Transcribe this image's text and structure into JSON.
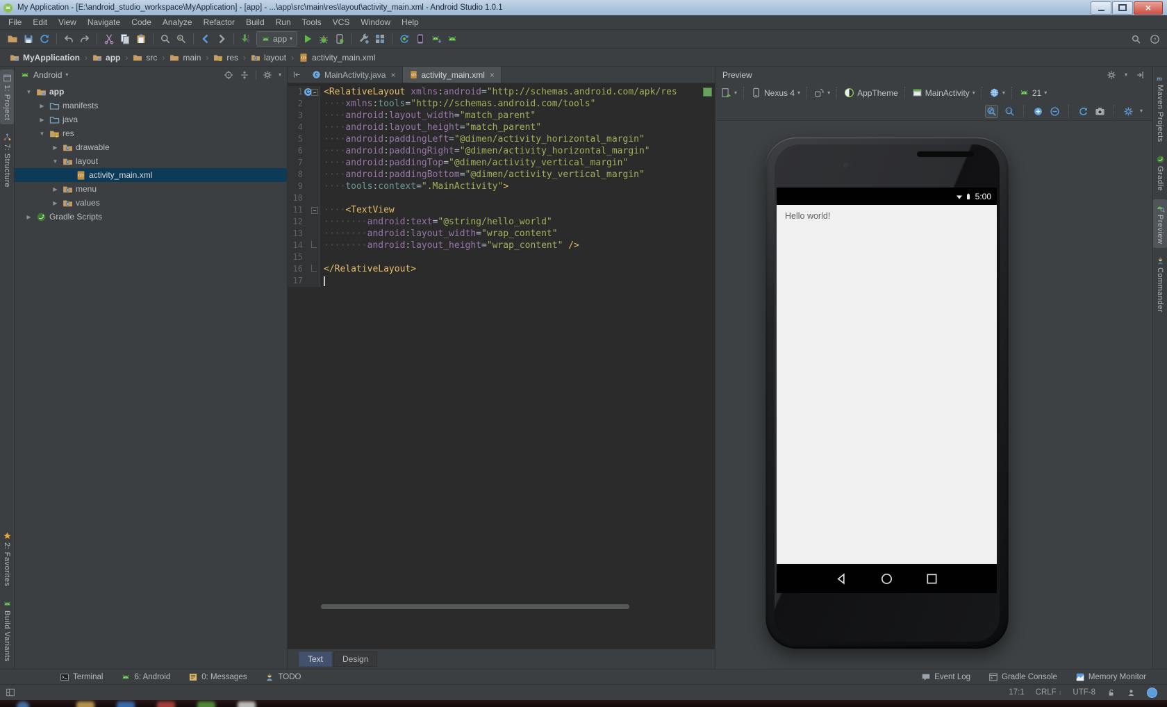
{
  "titlebar": {
    "title": "My Application - [E:\\android_studio_workspace\\MyApplication] - [app] - ...\\app\\src\\main\\res\\layout\\activity_main.xml - Android Studio 1.0.1"
  },
  "menubar": [
    "File",
    "Edit",
    "View",
    "Navigate",
    "Code",
    "Analyze",
    "Refactor",
    "Build",
    "Run",
    "Tools",
    "VCS",
    "Window",
    "Help"
  ],
  "toolbar": {
    "run_config": "app",
    "items": [
      {
        "icon": "folderOpen",
        "name": "open-file"
      },
      {
        "icon": "save",
        "name": "save-all"
      },
      {
        "icon": "sync",
        "name": "synchronize"
      },
      {
        "sep": true
      },
      {
        "icon": "undo",
        "name": "undo"
      },
      {
        "icon": "redo",
        "name": "redo"
      },
      {
        "sep": true
      },
      {
        "icon": "cut",
        "name": "cut"
      },
      {
        "icon": "copy",
        "name": "copy"
      },
      {
        "icon": "paste",
        "name": "paste"
      },
      {
        "sep": true
      },
      {
        "icon": "find",
        "name": "find"
      },
      {
        "icon": "replace",
        "name": "replace"
      },
      {
        "sep": true
      },
      {
        "icon": "back",
        "name": "navigate-back"
      },
      {
        "icon": "forward",
        "name": "navigate-forward"
      },
      {
        "sep": true
      },
      {
        "icon": "compile",
        "name": "make-project"
      },
      {
        "combo": true,
        "name": "run-configuration"
      },
      {
        "icon": "run",
        "name": "run-app"
      },
      {
        "icon": "debug",
        "name": "debug-app"
      },
      {
        "icon": "attach",
        "name": "attach-debugger"
      },
      {
        "sep": true
      },
      {
        "icon": "wrench",
        "name": "settings"
      },
      {
        "icon": "structure",
        "name": "project-structure"
      },
      {
        "sep": true
      },
      {
        "icon": "gradleSync",
        "name": "sync-gradle"
      },
      {
        "icon": "avd",
        "name": "avd-manager"
      },
      {
        "icon": "sdk",
        "name": "sdk-manager"
      },
      {
        "icon": "androidHead",
        "name": "android-device-monitor"
      }
    ],
    "right": [
      {
        "icon": "find",
        "name": "search-everywhere"
      },
      {
        "icon": "help",
        "name": "help"
      }
    ]
  },
  "breadcrumbs": [
    {
      "label": "MyApplication",
      "icon": "moduleFolder",
      "bold": true
    },
    {
      "label": "app",
      "icon": "moduleFolder",
      "bold": true
    },
    {
      "label": "src",
      "icon": "folder",
      "bold": false
    },
    {
      "label": "main",
      "icon": "folder",
      "bold": false
    },
    {
      "label": "res",
      "icon": "resFolder",
      "bold": false
    },
    {
      "label": "layout",
      "icon": "restypeFolder",
      "bold": false
    },
    {
      "label": "activity_main.xml",
      "icon": "xmlFile",
      "bold": false
    }
  ],
  "left_stripe": {
    "top": [
      {
        "label": "1: Project",
        "icon": "projectTab",
        "active": true
      },
      {
        "label": "7: Structure",
        "icon": "structTab",
        "active": false
      }
    ],
    "bottom": [
      {
        "label": "2: Favorites",
        "icon": "star",
        "active": false
      },
      {
        "label": "Build Variants",
        "icon": "androidHead",
        "active": false
      }
    ]
  },
  "right_stripe": [
    {
      "label": "Maven Projects",
      "icon": "maven",
      "active": false
    },
    {
      "label": "Gradle",
      "icon": "gradle",
      "active": false
    },
    {
      "label": "Preview",
      "icon": "previewTab",
      "active": true
    },
    {
      "label": "Commander",
      "icon": "commander",
      "active": false
    }
  ],
  "project": {
    "view": "Android",
    "tree": [
      {
        "label": "app",
        "level": 0,
        "expand": "open",
        "icon": "moduleFolder",
        "bold": true,
        "selected": false
      },
      {
        "label": "manifests",
        "level": 1,
        "expand": "closed",
        "icon": "sourceFolder",
        "bold": false,
        "selected": false
      },
      {
        "label": "java",
        "level": 1,
        "expand": "closed",
        "icon": "sourceFolder",
        "bold": false,
        "selected": false
      },
      {
        "label": "res",
        "level": 1,
        "expand": "open",
        "icon": "resFolder",
        "bold": false,
        "selected": false
      },
      {
        "label": "drawable",
        "level": 2,
        "expand": "closed",
        "icon": "restypeFolder",
        "bold": false,
        "selected": false
      },
      {
        "label": "layout",
        "level": 2,
        "expand": "open",
        "icon": "restypeFolder",
        "bold": false,
        "selected": false
      },
      {
        "label": "activity_main.xml",
        "level": 3,
        "expand": "none",
        "icon": "xmlFile",
        "bold": false,
        "selected": true
      },
      {
        "label": "menu",
        "level": 2,
        "expand": "closed",
        "icon": "restypeFolder",
        "bold": false,
        "selected": false
      },
      {
        "label": "values",
        "level": 2,
        "expand": "closed",
        "icon": "restypeFolder",
        "bold": false,
        "selected": false
      },
      {
        "label": "Gradle Scripts",
        "level": 0,
        "expand": "closed",
        "icon": "gradle",
        "bold": false,
        "selected": false
      }
    ]
  },
  "editor": {
    "tabs": [
      {
        "label": "MainActivity.java",
        "icon": "classFile",
        "active": false
      },
      {
        "label": "activity_main.xml",
        "icon": "xmlFile",
        "active": true
      }
    ],
    "mode_tabs": [
      {
        "label": "Text",
        "active": true
      },
      {
        "label": "Design",
        "active": false
      }
    ],
    "lines": [
      {
        "n": 1,
        "g": "cf",
        "s": [
          [
            "tag",
            "<RelativeLayout"
          ],
          [
            "pl",
            " "
          ],
          [
            "ns",
            "xmlns"
          ],
          [
            "pl",
            ":"
          ],
          [
            "ns",
            "android"
          ],
          [
            "pl",
            "="
          ],
          [
            "str",
            "\"http://schemas.android.com/apk/res"
          ]
        ]
      },
      {
        "n": 2,
        "s": [
          [
            "ws",
            "    "
          ],
          [
            "ns",
            "xmlns"
          ],
          [
            "pl",
            ":"
          ],
          [
            "tns",
            "tools"
          ],
          [
            "pl",
            "="
          ],
          [
            "str",
            "\"http://schemas.android.com/tools\""
          ]
        ]
      },
      {
        "n": 3,
        "s": [
          [
            "ws",
            "    "
          ],
          [
            "ns",
            "android"
          ],
          [
            "pl",
            ":"
          ],
          [
            "attr",
            "layout_width"
          ],
          [
            "pl",
            "="
          ],
          [
            "str",
            "\"match_parent\""
          ]
        ]
      },
      {
        "n": 4,
        "s": [
          [
            "ws",
            "    "
          ],
          [
            "ns",
            "android"
          ],
          [
            "pl",
            ":"
          ],
          [
            "attr",
            "layout_height"
          ],
          [
            "pl",
            "="
          ],
          [
            "str",
            "\"match_parent\""
          ]
        ]
      },
      {
        "n": 5,
        "s": [
          [
            "ws",
            "    "
          ],
          [
            "ns",
            "android"
          ],
          [
            "pl",
            ":"
          ],
          [
            "attr",
            "paddingLeft"
          ],
          [
            "pl",
            "="
          ],
          [
            "str",
            "\"@dimen/activity_horizontal_margin\""
          ]
        ]
      },
      {
        "n": 6,
        "s": [
          [
            "ws",
            "    "
          ],
          [
            "ns",
            "android"
          ],
          [
            "pl",
            ":"
          ],
          [
            "attr",
            "paddingRight"
          ],
          [
            "pl",
            "="
          ],
          [
            "str",
            "\"@dimen/activity_horizontal_margin\""
          ]
        ]
      },
      {
        "n": 7,
        "s": [
          [
            "ws",
            "    "
          ],
          [
            "ns",
            "android"
          ],
          [
            "pl",
            ":"
          ],
          [
            "attr",
            "paddingTop"
          ],
          [
            "pl",
            "="
          ],
          [
            "str",
            "\"@dimen/activity_vertical_margin\""
          ]
        ]
      },
      {
        "n": 8,
        "s": [
          [
            "ws",
            "    "
          ],
          [
            "ns",
            "android"
          ],
          [
            "pl",
            ":"
          ],
          [
            "attr",
            "paddingBottom"
          ],
          [
            "pl",
            "="
          ],
          [
            "str",
            "\"@dimen/activity_vertical_margin\""
          ]
        ]
      },
      {
        "n": 9,
        "s": [
          [
            "ws",
            "    "
          ],
          [
            "tns",
            "tools"
          ],
          [
            "pl",
            ":"
          ],
          [
            "tattr",
            "context"
          ],
          [
            "pl",
            "="
          ],
          [
            "str",
            "\".MainActivity\""
          ],
          [
            "tag",
            ">"
          ]
        ]
      },
      {
        "n": 10,
        "s": []
      },
      {
        "n": 11,
        "g": "fs",
        "s": [
          [
            "ws",
            "    "
          ],
          [
            "tag",
            "<TextView"
          ]
        ]
      },
      {
        "n": 12,
        "s": [
          [
            "ws",
            "        "
          ],
          [
            "ns",
            "android"
          ],
          [
            "pl",
            ":"
          ],
          [
            "attr",
            "text"
          ],
          [
            "pl",
            "="
          ],
          [
            "str",
            "\"@string/hello_world\""
          ]
        ]
      },
      {
        "n": 13,
        "s": [
          [
            "ws",
            "        "
          ],
          [
            "ns",
            "android"
          ],
          [
            "pl",
            ":"
          ],
          [
            "attr",
            "layout_width"
          ],
          [
            "pl",
            "="
          ],
          [
            "str",
            "\"wrap_content\""
          ]
        ]
      },
      {
        "n": 14,
        "g": "fe",
        "s": [
          [
            "ws",
            "        "
          ],
          [
            "ns",
            "android"
          ],
          [
            "pl",
            ":"
          ],
          [
            "attr",
            "layout_height"
          ],
          [
            "pl",
            "="
          ],
          [
            "str",
            "\"wrap_content\""
          ],
          [
            "tag",
            " />"
          ]
        ]
      },
      {
        "n": 15,
        "s": []
      },
      {
        "n": 16,
        "g": "fe",
        "s": [
          [
            "tag",
            "</RelativeLayout>"
          ]
        ]
      },
      {
        "n": 17,
        "caret": true,
        "s": []
      }
    ]
  },
  "preview": {
    "title": "Preview",
    "config_items": [
      {
        "icon": "variant",
        "dd": true,
        "name": "layout-variants"
      },
      {
        "sep": true
      },
      {
        "icon": "device",
        "label": "Nexus 4",
        "dd": true,
        "name": "device-selector"
      },
      {
        "sep": true
      },
      {
        "icon": "orientation",
        "dd": true,
        "name": "orientation-selector"
      },
      {
        "sep": true
      },
      {
        "icon": "theme",
        "label": "AppTheme",
        "name": "theme-selector"
      },
      {
        "sep": true
      },
      {
        "icon": "activity",
        "label": "MainActivity",
        "dd": true,
        "name": "activity-selector"
      },
      {
        "sep": true
      },
      {
        "icon": "globe",
        "dd": true,
        "name": "locale-selector"
      },
      {
        "sep": true
      },
      {
        "icon": "androidHead",
        "label": "21",
        "dd": true,
        "name": "api-level-selector"
      }
    ],
    "zoom_items": [
      {
        "icon": "zoomFit",
        "name": "zoom-to-fit",
        "active": true
      },
      {
        "icon": "zoomActual",
        "name": "zoom-actual-size"
      },
      {
        "sep": true
      },
      {
        "icon": "zoomIn",
        "name": "zoom-in"
      },
      {
        "icon": "zoomOut",
        "name": "zoom-out"
      },
      {
        "sep": true
      },
      {
        "icon": "sync",
        "name": "refresh-preview"
      },
      {
        "icon": "camera",
        "name": "save-screenshot"
      },
      {
        "sep": true
      },
      {
        "icon": "gearBlue",
        "name": "preview-settings",
        "dd": true
      }
    ],
    "device_screen": {
      "time": "5:00",
      "content_text": "Hello world!"
    }
  },
  "bottom_bar": {
    "left": [
      {
        "label": "Terminal",
        "icon": "terminal"
      },
      {
        "label": "6: Android",
        "icon": "androidHead"
      },
      {
        "label": "0: Messages",
        "icon": "messages"
      },
      {
        "label": "TODO",
        "icon": "todo"
      }
    ],
    "right": [
      {
        "label": "Event Log",
        "icon": "balloon"
      },
      {
        "label": "Gradle Console",
        "icon": "console"
      },
      {
        "label": "Memory Monitor",
        "icon": "memory"
      }
    ]
  },
  "statusbar": {
    "caret_position": "17:1",
    "line_separator": "CRLF",
    "encoding": "UTF-8"
  }
}
